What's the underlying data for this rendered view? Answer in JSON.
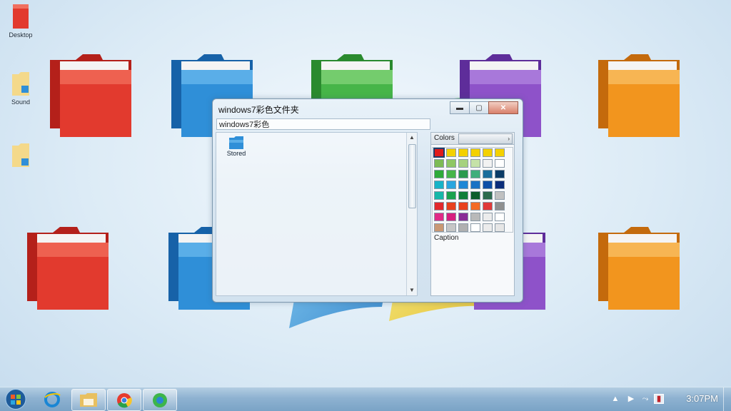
{
  "desktop": {
    "icons": [
      {
        "label": "Desktop"
      },
      {
        "label": "Sound"
      },
      {
        "label": ""
      }
    ]
  },
  "window": {
    "title": "windows7彩色文件夹",
    "address": "windows7彩色",
    "controls": {
      "minimize": "▬",
      "maximize": "▢",
      "close": "✕"
    },
    "file": {
      "label": "Stored"
    },
    "colors_panel": {
      "header": "Colors",
      "arrow": "›",
      "caption": "Caption",
      "selected_swatch": "#e01b1b",
      "swatches": [
        "#e01b1b",
        "#f4d100",
        "#f4d100",
        "#f4d100",
        "#f4d100",
        "#f4d100",
        "#7dbb55",
        "#8fc765",
        "#a6d27f",
        "#c5e2a8",
        "#f2f2f2",
        "#ffffff",
        "#2eaa3a",
        "#46b54a",
        "#2a9a4f",
        "#3fae7c",
        "#1a6d9c",
        "#0a3b66",
        "#17b3c7",
        "#29a6df",
        "#1e88d6",
        "#1a72c4",
        "#0d4fa7",
        "#0a2d7a",
        "#16b7a8",
        "#1aa24f",
        "#0f7f3a",
        "#0b5e2d",
        "#2b6a4e",
        "#c0c0c0",
        "#e2282c",
        "#e8411e",
        "#e8411e",
        "#f46b26",
        "#e03a3a",
        "#8f8f8f",
        "#e02b86",
        "#d71f7f",
        "#8a2b96",
        "#b9b9b9",
        "#ececec",
        "#ffffff",
        "#c99874",
        "#c6c6c6",
        "#b0b0b0",
        "#ffffff",
        "#ececec",
        "#e6e6e6"
      ]
    }
  },
  "taskbar": {
    "clock": "3:07PM",
    "tray": {
      "flag": "▶",
      "speaker": "⤳"
    }
  },
  "colors": {
    "red": "#e23a2e",
    "blue": "#2f8fd8",
    "green": "#46b548",
    "purple": "#8e52c9",
    "orange": "#f2951e"
  }
}
